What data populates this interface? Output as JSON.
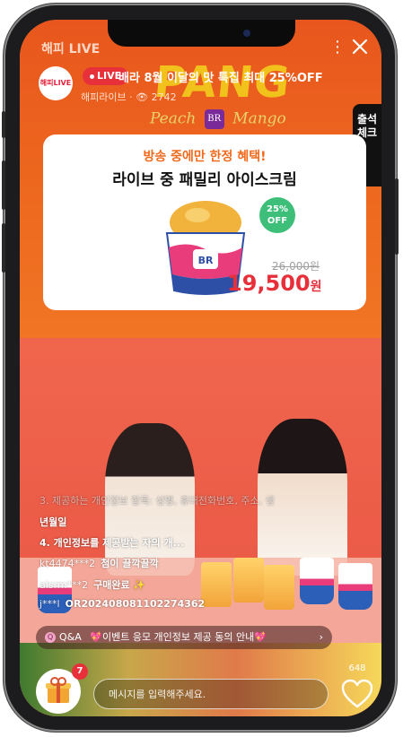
{
  "header": {
    "app_title": "해피 LIVE",
    "more_icon": "more-vertical-icon",
    "close_icon": "close-icon"
  },
  "stream": {
    "logo_text": "해피LIVE",
    "live_label": "LIVE",
    "title": "배라 8월 이달의 맛 특집 최대 25%OFF",
    "channel": "해피라이브",
    "viewers": "2742",
    "attendance_label": "출석체크"
  },
  "banner": {
    "headline": "PANG",
    "flavor_left": "Peach",
    "flavor_right": "Mango",
    "brand": "BR"
  },
  "promo": {
    "subtitle": "방송 중에만 한정 혜택!",
    "title": "라이브 중 패밀리 아이스크림",
    "discount_pct": "25%",
    "discount_label": "OFF",
    "original_price": "26,000원",
    "sale_price": "19,500",
    "currency": "원"
  },
  "chat": {
    "messages": [
      {
        "nick": "",
        "text": "3. 제공하는 개인정보 항목: 성명, 휴대전화번호, 주소, 생"
      },
      {
        "nick": "",
        "text": "년월일"
      },
      {
        "nick": "",
        "text": "4. 개인정보를 제공받는 자의 개..."
      },
      {
        "nick": "kt4474***2",
        "text": "첨이 끌깍끌깍"
      },
      {
        "nick": "alsrm***2",
        "text": "구매완료 ✨"
      },
      {
        "nick": "j***l",
        "text": "OR20240808110227436​2"
      }
    ]
  },
  "qna": {
    "label": "Q&A",
    "text": "💖이벤트 응모 개인정보 제공 동의 안내💖",
    "chevron": "›"
  },
  "bottom": {
    "gift_badge": "7",
    "message_placeholder": "메시지를 입력해주세요.",
    "likes": "648"
  },
  "colors": {
    "accent_red": "#e8303a",
    "promo_orange": "#ef6a1c",
    "discount_green": "#3dbf7a"
  }
}
